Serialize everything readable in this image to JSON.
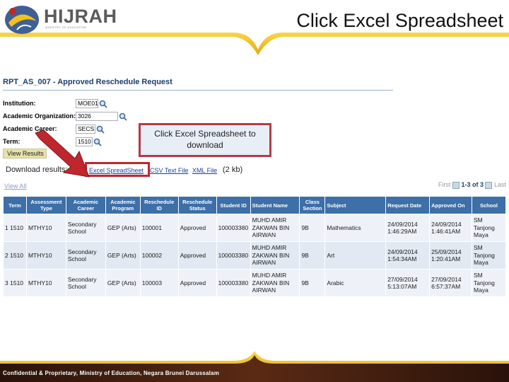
{
  "header": {
    "logo_text": "HIJRAH",
    "logo_subtext": "MINISTRY OF EDUCATION",
    "slide_title": "Click Excel Spreadsheet"
  },
  "report": {
    "title": "RPT_AS_007 - Approved Reschedule Request",
    "fields": [
      {
        "label": "Institution:",
        "value": "MOE01"
      },
      {
        "label": "Academic Organization:",
        "value": "3026"
      },
      {
        "label": "Academic Career:",
        "value": "SECS"
      },
      {
        "label": "Term:",
        "value": "1510"
      }
    ],
    "view_results_label": "View Results",
    "download_label": "Download results:",
    "download_links": [
      "Excel SpreadSheet",
      "CSV Text File",
      "XML File"
    ],
    "download_size": "(2 kb)",
    "view_all": "View All",
    "pager": {
      "first": "First",
      "count": "1-3 of 3",
      "last": "Last"
    }
  },
  "grid": {
    "columns": [
      "Term",
      "Assessment Type",
      "Academic Career",
      "Academic Program",
      "Reschedule ID",
      "Reschedule Status",
      "Student ID",
      "Student Name",
      "Class Section",
      "Subject",
      "Request Date",
      "Approved On",
      "School"
    ],
    "rows": [
      {
        "num": "1",
        "term": "1510",
        "type": "MTHY10",
        "career": "Secondary School",
        "program": "GEP (Arts)",
        "id": "100001",
        "status": "Approved",
        "student_id": "100003380",
        "name": "MUHD AMIR ZAKWAN BIN AIRWAN",
        "section": "9B",
        "subject": "Mathematics",
        "request": "24/09/2014 1:46:29AM",
        "approved": "24/09/2014 1:46:41AM",
        "school": "SM Tanjong Maya"
      },
      {
        "num": "2",
        "term": "1510",
        "type": "MTHY10",
        "career": "Secondary School",
        "program": "GEP (Arts)",
        "id": "100002",
        "status": "Approved",
        "student_id": "100003380",
        "name": "MUHD AMIR ZAKWAN BIN AIRWAN",
        "section": "9B",
        "subject": "Art",
        "request": "24/09/2014 1:54:34AM",
        "approved": "25/09/2014 1:20:41AM",
        "school": "SM Tanjong Maya"
      },
      {
        "num": "3",
        "term": "1510",
        "type": "MTHY10",
        "career": "Secondary School",
        "program": "GEP (Arts)",
        "id": "100003",
        "status": "Approved",
        "student_id": "100003380",
        "name": "MUHD AMIR ZAKWAN BIN AIRWAN",
        "section": "9B",
        "subject": "Arabic",
        "request": "27/09/2014 5:13:07AM",
        "approved": "27/09/2014 6:57:37AM",
        "school": "SM Tanjong Maya"
      }
    ]
  },
  "callout": {
    "text": "Click Excel Spreadsheet to download"
  },
  "footer": {
    "text": "Confidential & Proprietary, Ministry of Education, Negara Brunei Darussalam"
  },
  "colors": {
    "header_yellow": "#f2c21b",
    "grid_header": "#3d6fa8",
    "highlight_red": "#c0272d",
    "footer_dark": "#3a1a10"
  }
}
